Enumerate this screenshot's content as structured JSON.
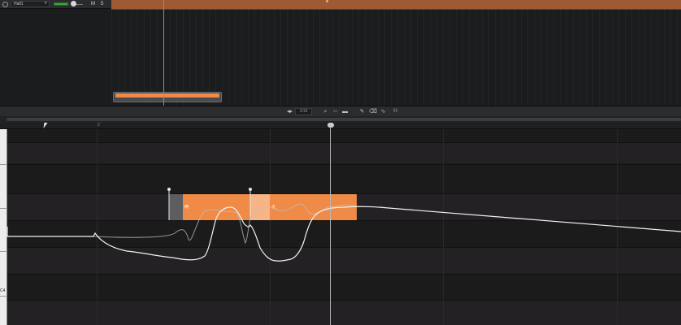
{
  "track": {
    "name": "Hafi1",
    "dropdown_glyph": "▾",
    "mute_label": "M",
    "solo_label": "S"
  },
  "toolbar": {
    "quantize_value": "1/16",
    "icons": [
      "quantize-icon",
      "zoom-icon",
      "fit-icon",
      "screen-icon",
      "pencil-icon",
      "eraser-icon",
      "curve-icon",
      "split-icon"
    ]
  },
  "ruler": {
    "bar_label": "2"
  },
  "keyboard": {
    "c4_label": "C4"
  },
  "notes": [
    {
      "lyric": "两"
    },
    {
      "lyric": "大"
    }
  ],
  "colors": {
    "accent_orange": "#ef8a47",
    "lane_orange": "#9d5a34",
    "background": "#161719"
  }
}
